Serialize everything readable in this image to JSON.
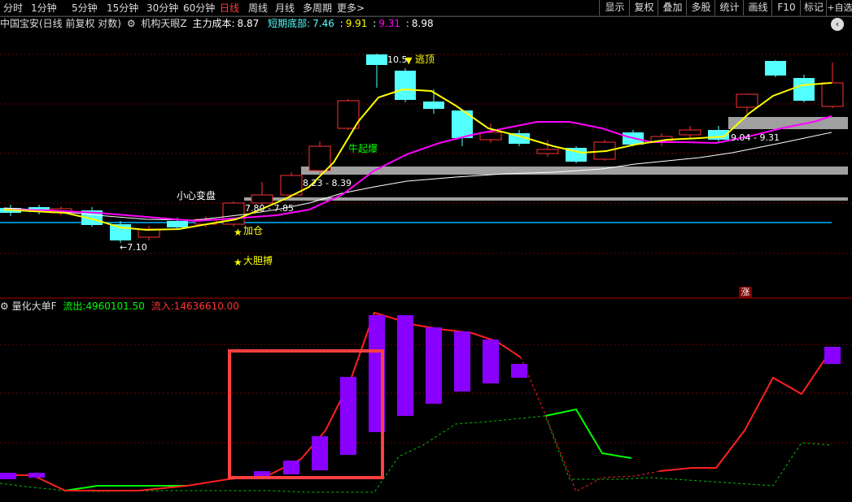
{
  "toolbar": {
    "tabs": [
      "分时",
      "1分钟",
      "5分钟",
      "15分钟",
      "30分钟",
      "60分钟",
      "日线",
      "周线",
      "月线",
      "多周期",
      "更多>"
    ],
    "active_tab": "日线",
    "right": [
      "显示",
      "复权",
      "叠加",
      "多股",
      "统计",
      "画线",
      "F10",
      "标记",
      "+自选"
    ]
  },
  "legend": {
    "stock": "中国宝安(日线 前复权 对数)",
    "indicator": "机构天眼Z",
    "cost_label": "主力成本:",
    "cost_value": "8.87",
    "short_label": "短期底部:",
    "short_value": "7.46",
    "v1": "9.91",
    "v2": "9.31",
    "v3": "8.98"
  },
  "scroll_icon": "‹",
  "main_chart": {
    "annotations": {
      "peak": "10.5",
      "escape": "逃顶",
      "bull": "牛起爆",
      "careful": "小心变盘",
      "add": "加仓",
      "bold": "大胆搏",
      "low": "←7.10",
      "zone1": "8.23 - 8.39",
      "zone2": "7.80 - 7.85",
      "zone3": "9.04 - 9.31",
      "rise_tag": "涨"
    }
  },
  "sub_chart": {
    "name": "量化大单F",
    "outflow_label": "流出:",
    "outflow_value": "4960101.50",
    "inflow_label": "流入:",
    "inflow_value": "14636610.00"
  },
  "colors": {
    "up": "#ff3232",
    "down": "#54ffff",
    "ma_yellow": "#ffff00",
    "ma_magenta": "#ff00ff",
    "ma_white": "#ffffff",
    "purple": "#8a00ff",
    "green": "#00ff00",
    "red": "#ff2020",
    "zone": "#a0a0a0"
  }
}
